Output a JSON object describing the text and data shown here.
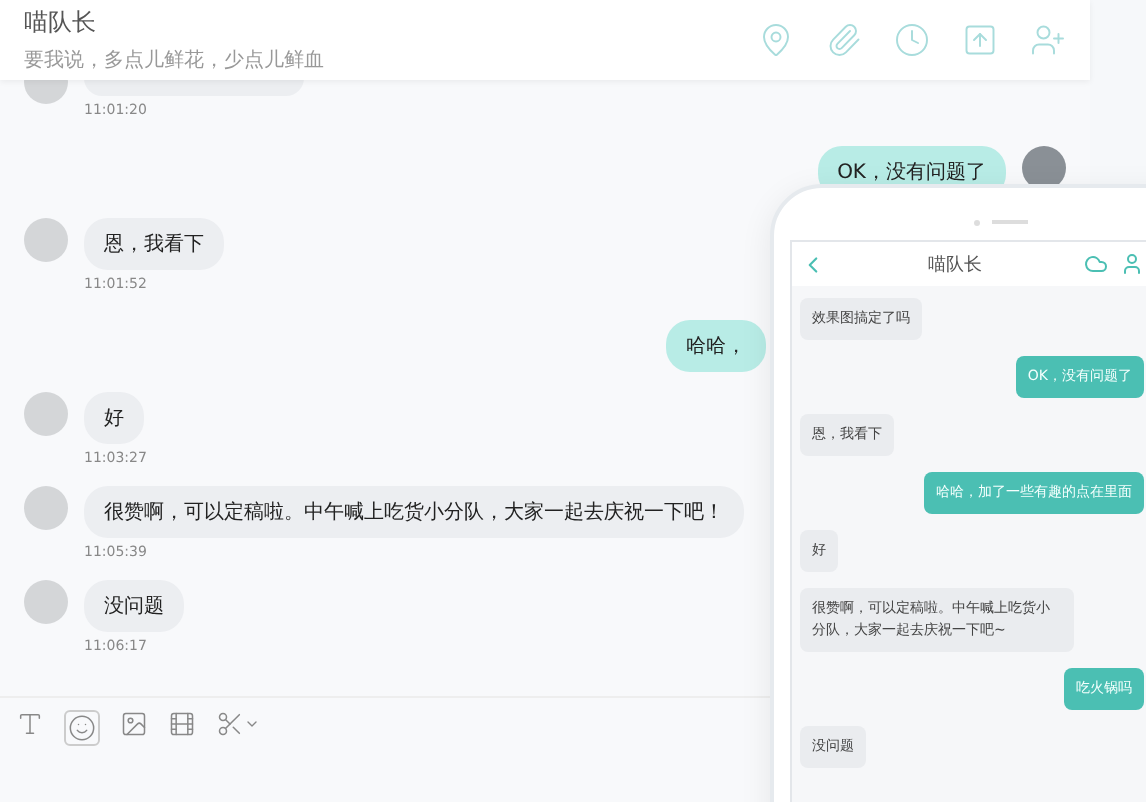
{
  "header": {
    "title": "喵队长",
    "subtitle": "要我说，多点儿鲜花，少点儿鲜血"
  },
  "messages": [
    {
      "kind": "incoming",
      "time": "11:01:20"
    },
    {
      "kind": "outgoing",
      "text": "OK，没有问题了",
      "avatar": true
    },
    {
      "kind": "incoming",
      "text": "恩，我看下",
      "time": "11:01:52"
    },
    {
      "kind": "outgoing",
      "text": "哈哈，",
      "avatar": false
    },
    {
      "kind": "incoming",
      "text": "好",
      "time": "11:03:27"
    },
    {
      "kind": "incoming",
      "text": "很赞啊，可以定稿啦。中午喊上吃货小分队，大家一起去庆祝一下吧！",
      "time": "11:05:39"
    },
    {
      "kind": "incoming",
      "text": "没问题",
      "time": "11:06:17"
    }
  ],
  "phone": {
    "title": "喵队长",
    "messages": [
      {
        "kind": "incoming",
        "text": "效果图搞定了吗"
      },
      {
        "kind": "outgoing",
        "text": "OK，没有问题了"
      },
      {
        "kind": "incoming",
        "text": "恩，我看下"
      },
      {
        "kind": "outgoing",
        "text": "哈哈，加了一些有趣的点在里面"
      },
      {
        "kind": "incoming",
        "text": "好"
      },
      {
        "kind": "incoming",
        "text": "很赞啊，可以定稿啦。中午喊上吃货小分队，大家一起去庆祝一下吧~"
      },
      {
        "kind": "outgoing",
        "text": "吃火锅吗"
      },
      {
        "kind": "incoming",
        "text": "没问题"
      }
    ]
  }
}
